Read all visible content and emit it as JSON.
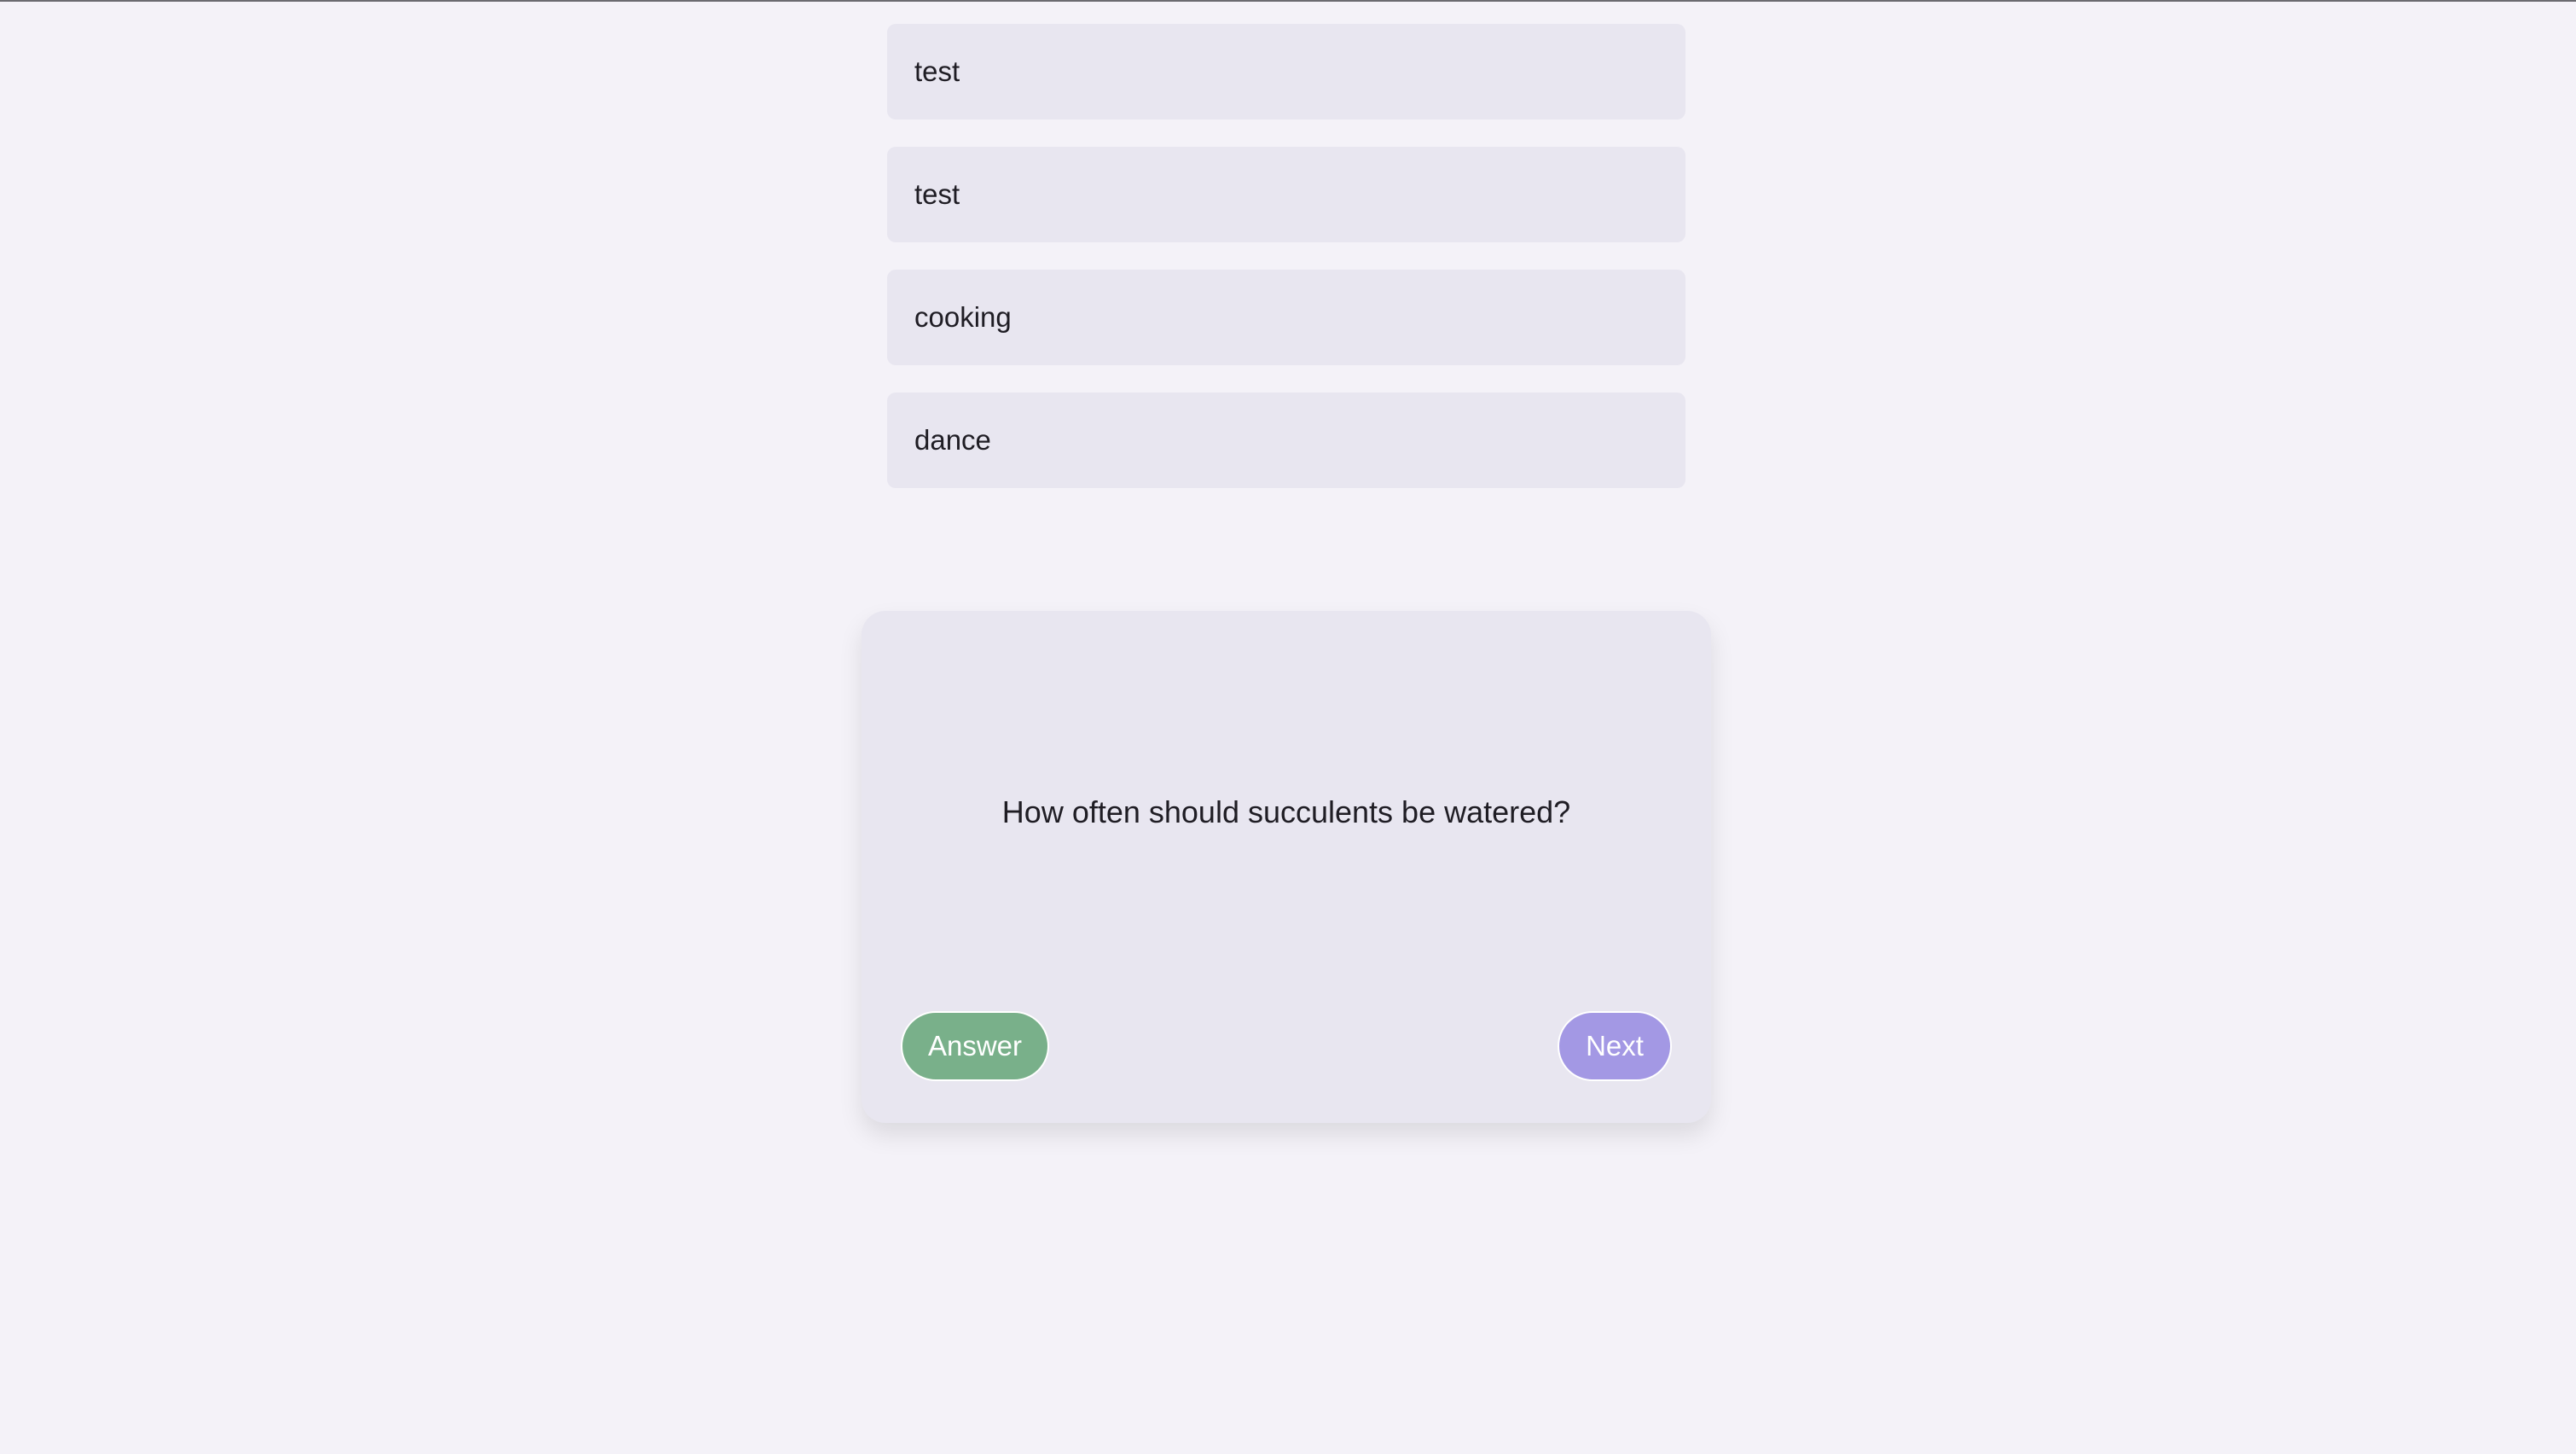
{
  "categories": [
    {
      "label": "test"
    },
    {
      "label": "test"
    },
    {
      "label": "cooking"
    },
    {
      "label": "dance"
    }
  ],
  "flashcard": {
    "question": "How often should succulents be watered?",
    "answer_label": "Answer",
    "next_label": "Next"
  },
  "colors": {
    "page_background": "#f4f2f8",
    "surface": "#e8e6f0",
    "answer_button": "#79b08a",
    "next_button": "#a398e4"
  }
}
